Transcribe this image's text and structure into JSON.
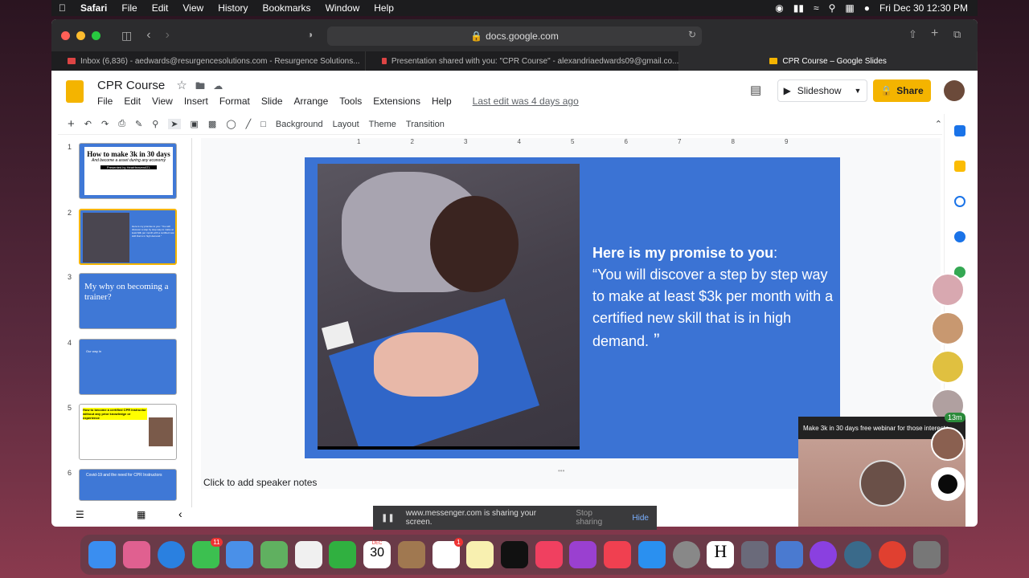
{
  "menubar": {
    "app": "Safari",
    "items": [
      "File",
      "Edit",
      "View",
      "History",
      "Bookmarks",
      "Window",
      "Help"
    ],
    "clock": "Fri Dec 30  12:30 PM"
  },
  "browser": {
    "url": "docs.google.com",
    "tabs": [
      {
        "label": "Inbox (6,836) - aedwards@resurgencesolutions.com - Resurgence Solutions..."
      },
      {
        "label": "Presentation shared with you: \"CPR Course\" - alexandriaedwards09@gmail.co..."
      },
      {
        "label": "CPR Course – Google Slides"
      }
    ]
  },
  "slides_app": {
    "title": "CPR Course",
    "menus": [
      "File",
      "Edit",
      "View",
      "Insert",
      "Format",
      "Slide",
      "Arrange",
      "Tools",
      "Extensions",
      "Help"
    ],
    "last_edit": "Last edit was 4 days ago",
    "slideshow_label": "Slideshow",
    "share_label": "Share",
    "toolbar": {
      "background": "Background",
      "layout": "Layout",
      "theme": "Theme",
      "transition": "Transition"
    },
    "speaker_notes": "Click to add speaker notes"
  },
  "filmstrip": [
    {
      "num": "1",
      "text": "How to make 3k in 30 days",
      "sub": "And become a asset during any economy",
      "footer": "Presented by HearHeavenATL"
    },
    {
      "num": "2",
      "text": "Here is my promise to you: \"You will discover a step by step way to make at least $3k per month with a certified new skill that is in high demand.\""
    },
    {
      "num": "3",
      "text": "My why on becoming a trainer?"
    },
    {
      "num": "4",
      "text": "Our way in"
    },
    {
      "num": "5",
      "text": "How to become a certified CPR Instructor without any prior knowledge or experience"
    },
    {
      "num": "6",
      "text": "Covid-19 and the need for CPR Instructors"
    }
  ],
  "slide": {
    "promise_bold": "Here is my promise to you",
    "promise_colon": ":",
    "promise_text": "“You will discover a step by step way to make at least $3k per month  with a certified new skill that is in high demand.",
    "promise_end": " ”"
  },
  "ruler": [
    "1",
    "2",
    "3",
    "4",
    "5",
    "6",
    "7",
    "8",
    "9"
  ],
  "sharebar": {
    "text": "www.messenger.com is sharing your screen.",
    "stop": "Stop sharing",
    "hide": "Hide"
  },
  "webinar": {
    "caption": "Make 3k in 30 days free webinar for those intereste...",
    "timer": "13m"
  },
  "dock": {
    "calendar_month": "DEC",
    "calendar_day": "30",
    "messages_badge": "11",
    "reminders_badge": "1"
  }
}
